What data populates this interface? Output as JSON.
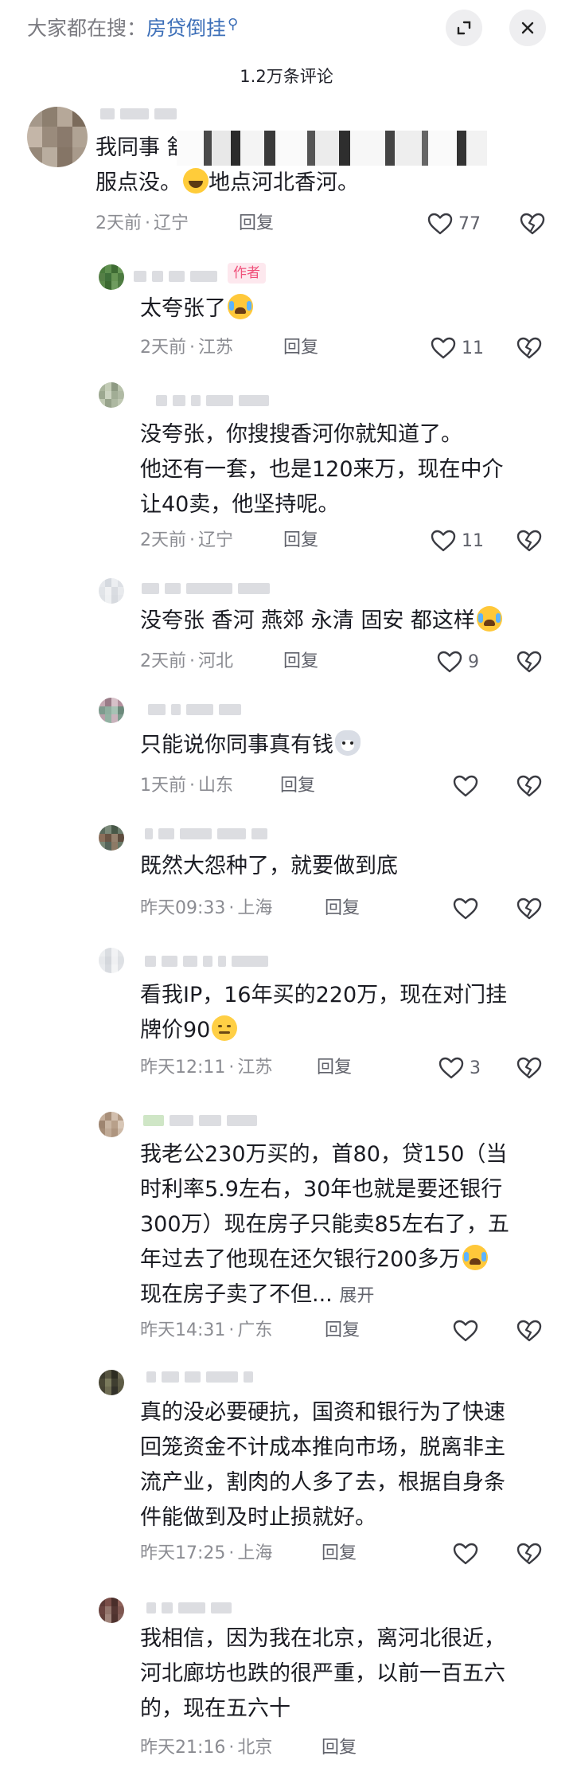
{
  "header": {
    "search_prefix": "大家都在搜：",
    "search_keyword": "房贷倒挂",
    "comment_count_title": "1.2万条评论"
  },
  "colors": {
    "keyword": "#3d6fb8",
    "author_tag_text": "#f0507a",
    "author_tag_bg": "#fde8ee",
    "meta_text": "#8b8c92"
  },
  "comments": [
    {
      "text": "我同事                    舒\n服点没。",
      "text_tail": "地点河北香河。",
      "time": "2天前",
      "location": "辽宁",
      "reply": "回复",
      "likes": "77",
      "emoji": "smile-emoji"
    },
    {
      "author_tag": "作者",
      "text": "太夸张了",
      "time": "2天前",
      "location": "江苏",
      "reply": "回复",
      "likes": "11",
      "emoji": "laugh-cry-emoji"
    },
    {
      "text": "没夸张，你搜搜香河你就知道了。\n他还有一套，也是120来万，现在中介\n让40卖，他坚持呢。",
      "time": "2天前",
      "location": "辽宁",
      "reply": "回复",
      "likes": "11"
    },
    {
      "text": "没夸张 香河 燕郊 永清 固安 都这样",
      "time": "2天前",
      "location": "河北",
      "reply": "回复",
      "likes": "9",
      "emoji": "laugh-cry-emoji"
    },
    {
      "text": "只能说你同事真有钱",
      "time": "1天前",
      "location": "山东",
      "reply": "回复",
      "likes": "",
      "emoji": "husky-emoji"
    },
    {
      "text": "既然大怨种了，就要做到底",
      "time": "昨天09:33",
      "location": "上海",
      "reply": "回复",
      "likes": ""
    },
    {
      "text": "看我IP，16年买的220万，现在对门挂\n牌价90",
      "time": "昨天12:11",
      "location": "江苏",
      "reply": "回复",
      "likes": "3",
      "emoji": "speechless-emoji"
    },
    {
      "text": "我老公230万买的，首80，贷150（当\n时利率5.9左右，30年也就是要还银行\n300万）现在房子只能卖85左右了，五\n年过去了他现在还欠银行200多万",
      "text_line5": "现在房子卖了不但...",
      "expand": "展开",
      "time": "昨天14:31",
      "location": "广东",
      "reply": "回复",
      "likes": "",
      "emoji": "laugh-cry-emoji"
    },
    {
      "text": "真的没必要硬抗，国资和银行为了快速\n回笼资金不计成本推向市场，脱离非主\n流产业，割肉的人多了去，根据自身条\n件能做到及时止损就好。",
      "time": "昨天17:25",
      "location": "上海",
      "reply": "回复",
      "likes": ""
    },
    {
      "text": "我相信，因为我在北京，离河北很近，\n河北廊坊也跌的很严重，以前一百五六\n的，现在五六十",
      "time": "昨天21:16",
      "location": "北京",
      "reply": "回复",
      "likes": ""
    }
  ]
}
